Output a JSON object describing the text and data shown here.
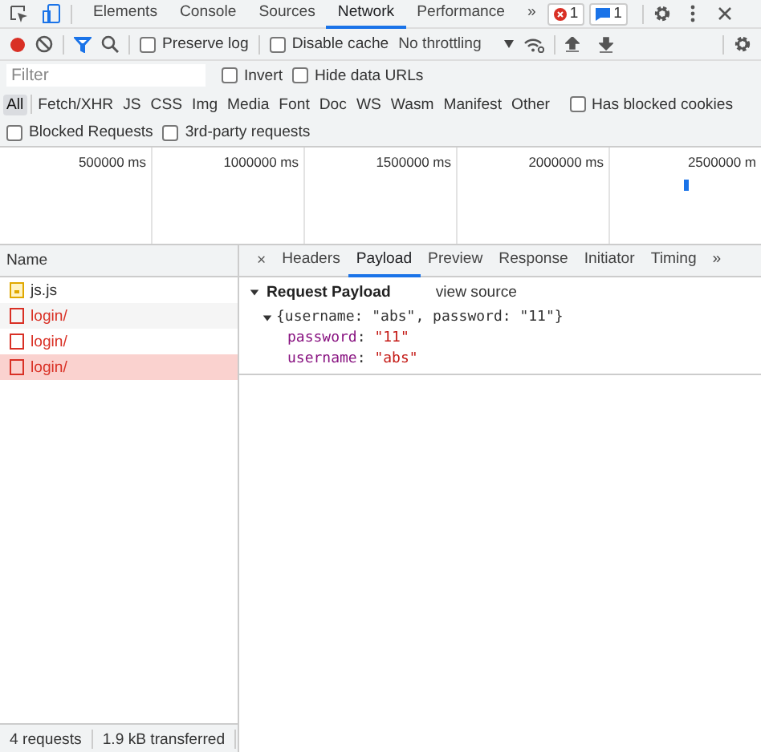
{
  "top_tabs": [
    {
      "label": "Elements",
      "selected": false
    },
    {
      "label": "Console",
      "selected": false
    },
    {
      "label": "Sources",
      "selected": false
    },
    {
      "label": "Network",
      "selected": true
    },
    {
      "label": "Performance",
      "selected": false
    }
  ],
  "more_tabs": "»",
  "badges": [
    {
      "kind": "error",
      "count": "1"
    },
    {
      "kind": "info",
      "count": "1"
    }
  ],
  "toolbar": {
    "recording": true,
    "filter_active": true,
    "checkboxes": [
      {
        "label": "Preserve log",
        "checked": false
      },
      {
        "label": "Disable cache",
        "checked": false
      }
    ],
    "throttling": "No throttling"
  },
  "filter": {
    "placeholder": "Filter",
    "options": [
      {
        "label": "Invert",
        "checked": false
      },
      {
        "label": "Hide data URLs",
        "checked": false
      }
    ]
  },
  "type_filters": [
    {
      "label": "All",
      "selected": true
    },
    {
      "label": "Fetch/XHR",
      "selected": false
    },
    {
      "label": "JS",
      "selected": false
    },
    {
      "label": "CSS",
      "selected": false
    },
    {
      "label": "Img",
      "selected": false
    },
    {
      "label": "Media",
      "selected": false
    },
    {
      "label": "Font",
      "selected": false
    },
    {
      "label": "Doc",
      "selected": false
    },
    {
      "label": "WS",
      "selected": false
    },
    {
      "label": "Wasm",
      "selected": false
    },
    {
      "label": "Manifest",
      "selected": false
    },
    {
      "label": "Other",
      "selected": false
    }
  ],
  "extra_options": [
    {
      "label": "Has blocked cookies",
      "checked": false
    },
    {
      "label": "Blocked Requests",
      "checked": false
    },
    {
      "label": "3rd-party requests",
      "checked": false
    }
  ],
  "overview": {
    "ticks": [
      "500000 ms",
      "1000000 ms",
      "1500000 ms",
      "2000000 ms",
      "2500000 m"
    ]
  },
  "requests": {
    "column": "Name",
    "rows": [
      {
        "name": "js.js",
        "kind": "script",
        "failed": false,
        "selected": false
      },
      {
        "name": "login/",
        "kind": "document",
        "failed": true,
        "selected": false
      },
      {
        "name": "login/",
        "kind": "document",
        "failed": true,
        "selected": false
      },
      {
        "name": "login/",
        "kind": "document",
        "failed": true,
        "selected": true
      }
    ]
  },
  "detail": {
    "close": "×",
    "tabs": [
      {
        "label": "Headers",
        "selected": false
      },
      {
        "label": "Payload",
        "selected": true
      },
      {
        "label": "Preview",
        "selected": false
      },
      {
        "label": "Response",
        "selected": false
      },
      {
        "label": "Initiator",
        "selected": false
      },
      {
        "label": "Timing",
        "selected": false
      }
    ],
    "more_tabs": "»",
    "section": {
      "title": "Request Payload",
      "expanded": true,
      "action": "view source",
      "object_expanded": true,
      "summary": "{username: \"abs\", password: \"11\"}",
      "fields": [
        {
          "key": "password",
          "separator": ":",
          "value": "\"11\""
        },
        {
          "key": "username",
          "separator": ":",
          "value": "\"abs\""
        }
      ]
    }
  },
  "status_bar": [
    "4 requests",
    "1.9 kB transferred"
  ]
}
